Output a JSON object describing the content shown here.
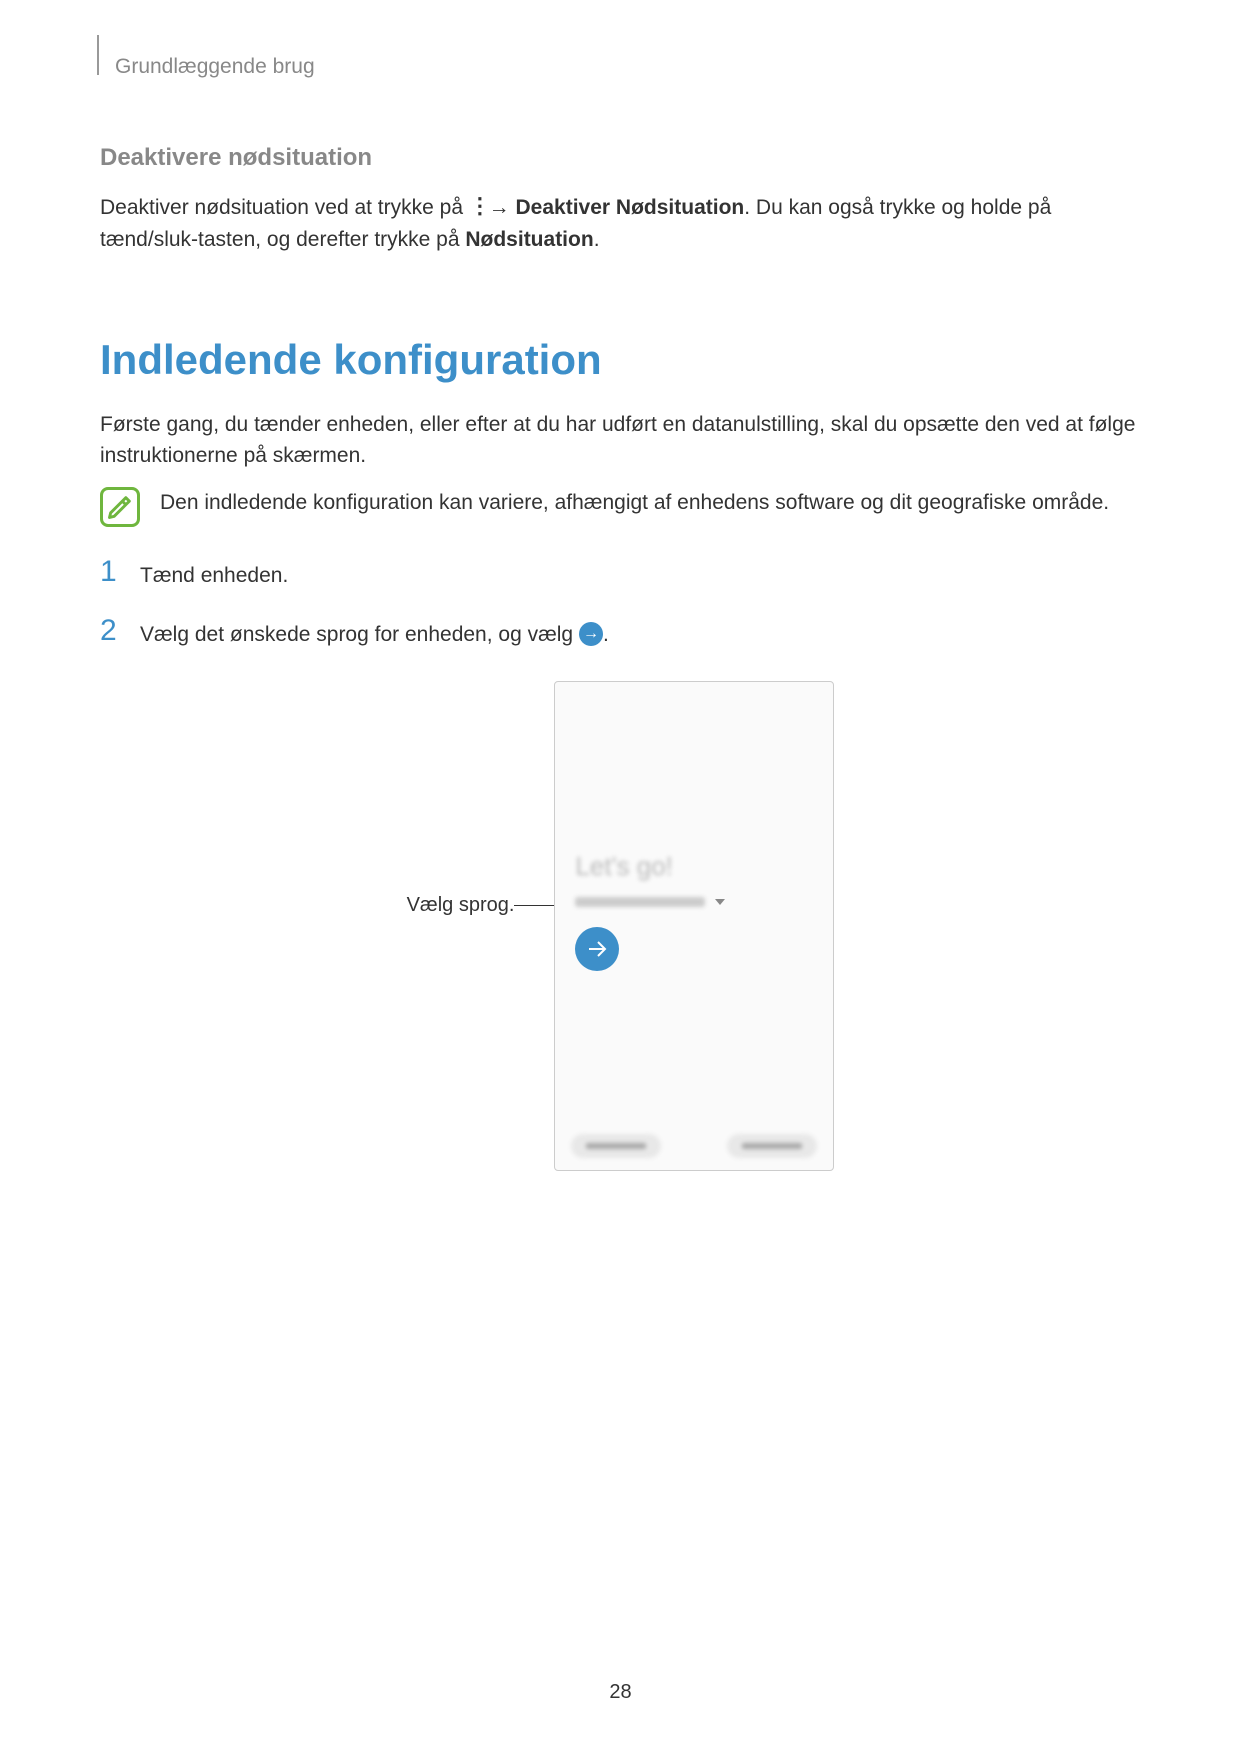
{
  "breadcrumb": "Grundlæggende brug",
  "section_title": "Deaktivere nødsituation",
  "paragraph1_part1": "Deaktiver nødsituation ved at trykke på ",
  "paragraph1_arrow": " → ",
  "paragraph1_bold1": "Deaktiver Nødsituation",
  "paragraph1_part2": ". Du kan også trykke og holde på tænd/sluk-tasten, og derefter trykke på ",
  "paragraph1_bold2": "Nødsituation",
  "paragraph1_end": ".",
  "main_heading": "Indledende konfiguration",
  "intro_text": "Første gang, du tænder enheden, eller efter at du har udført en datanulstilling, skal du opsætte den ved at følge instruktionerne på skærmen.",
  "note_text": "Den indledende konfiguration kan variere, afhængigt af enhedens software og dit geografiske område.",
  "step1_number": "1",
  "step1_text": "Tænd enheden.",
  "step2_number": "2",
  "step2_text_part1": "Vælg det ønskede sprog for enheden, og vælg ",
  "step2_text_end": ".",
  "callout_label": "Vælg sprog.",
  "phone_title": "Let's go!",
  "page_number": "28"
}
